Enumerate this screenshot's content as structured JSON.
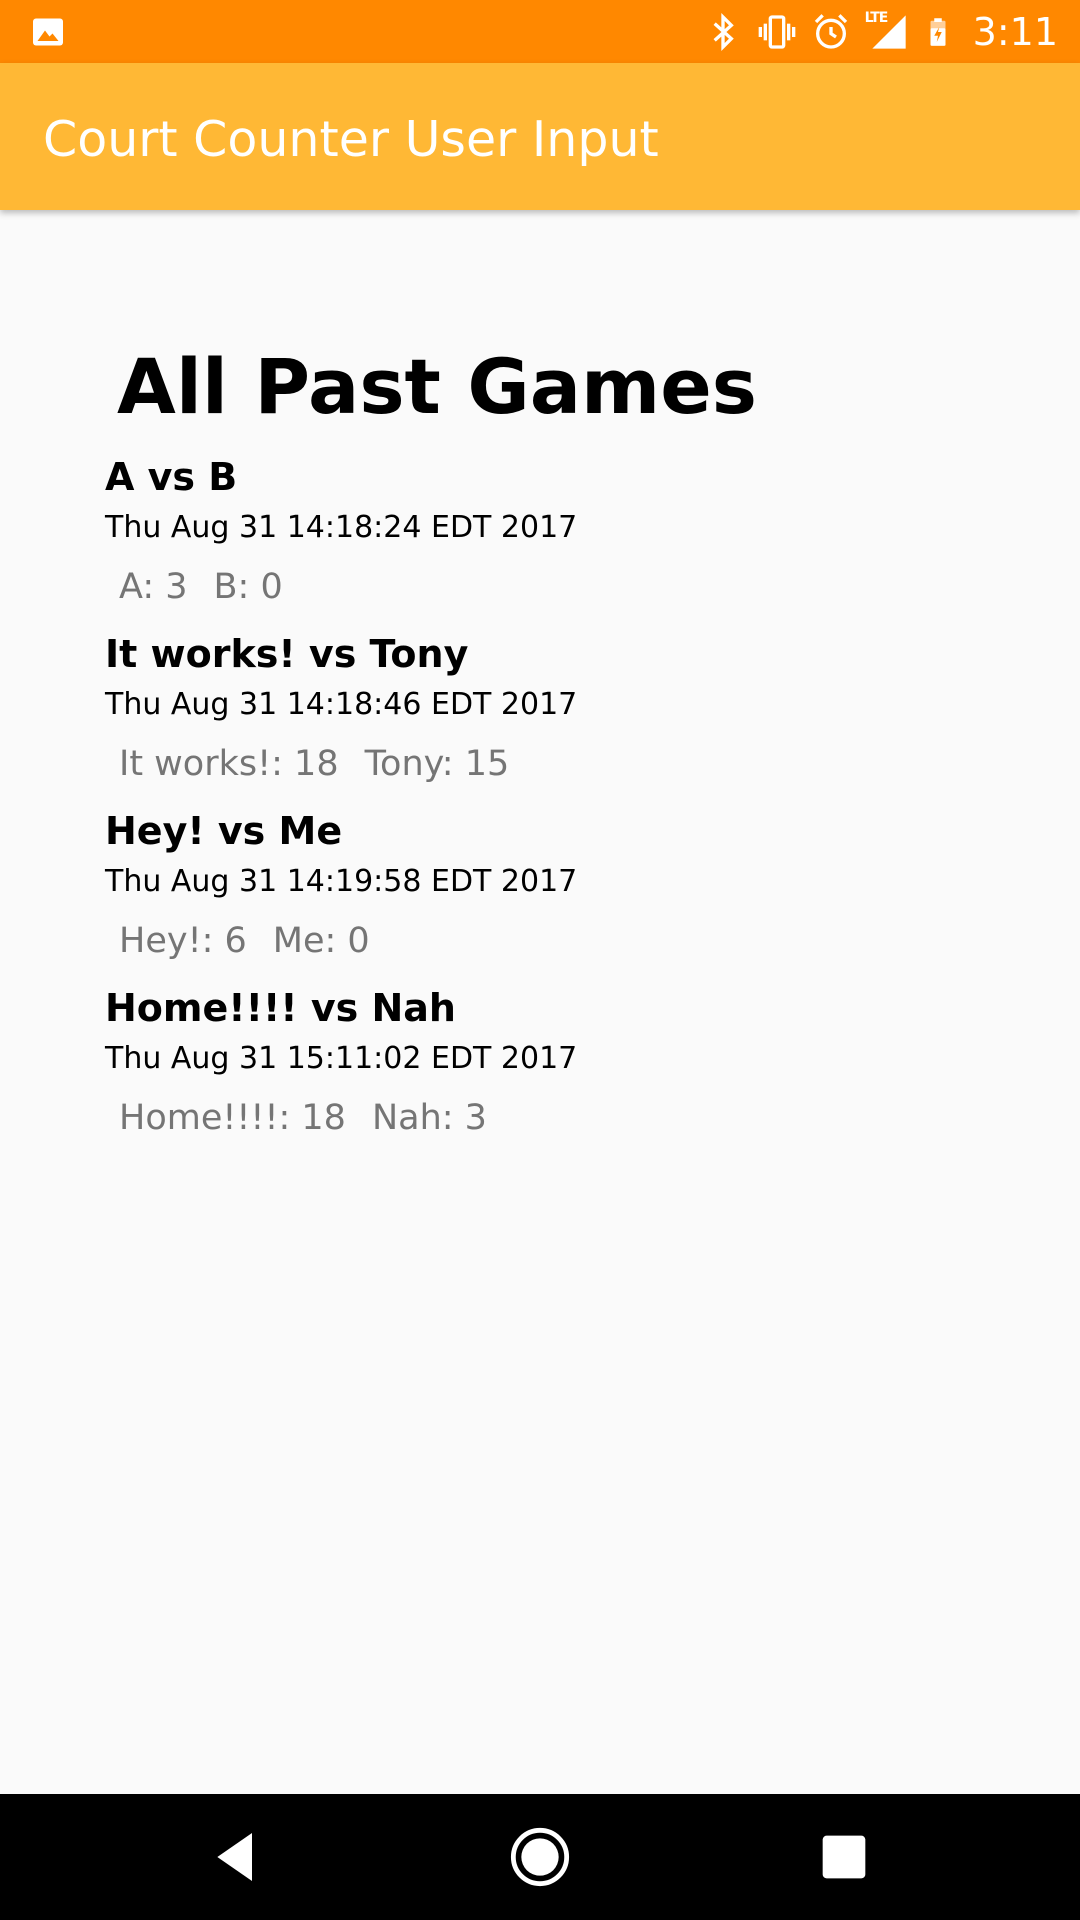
{
  "status_bar": {
    "time": "3:11",
    "network_label": "LTE",
    "icons": [
      "gallery-icon",
      "bluetooth-icon",
      "vibrate-icon",
      "alarm-icon",
      "signal-icon",
      "battery-charging-icon"
    ],
    "background_color": "#ff8800"
  },
  "app_bar": {
    "title": "Court Counter User Input",
    "background_color": "#ffb835"
  },
  "main": {
    "heading": "All Past Games",
    "games": [
      {
        "title": "A vs B",
        "date": "Thu Aug 31 14:18:24 EDT 2017",
        "score_a": "A: 3",
        "score_b": "B: 0"
      },
      {
        "title": "It works! vs Tony",
        "date": "Thu Aug 31 14:18:46 EDT 2017",
        "score_a": "It works!: 18",
        "score_b": "Tony: 15"
      },
      {
        "title": "Hey! vs Me",
        "date": "Thu Aug 31 14:19:58 EDT 2017",
        "score_a": "Hey!: 6",
        "score_b": "Me: 0"
      },
      {
        "title": "Home!!!! vs Nah",
        "date": "Thu Aug 31 15:11:02 EDT 2017",
        "score_a": "Home!!!!: 18",
        "score_b": "Nah: 3"
      }
    ]
  },
  "nav_bar": {
    "icons": [
      "back-icon",
      "home-icon",
      "recents-icon"
    ]
  }
}
